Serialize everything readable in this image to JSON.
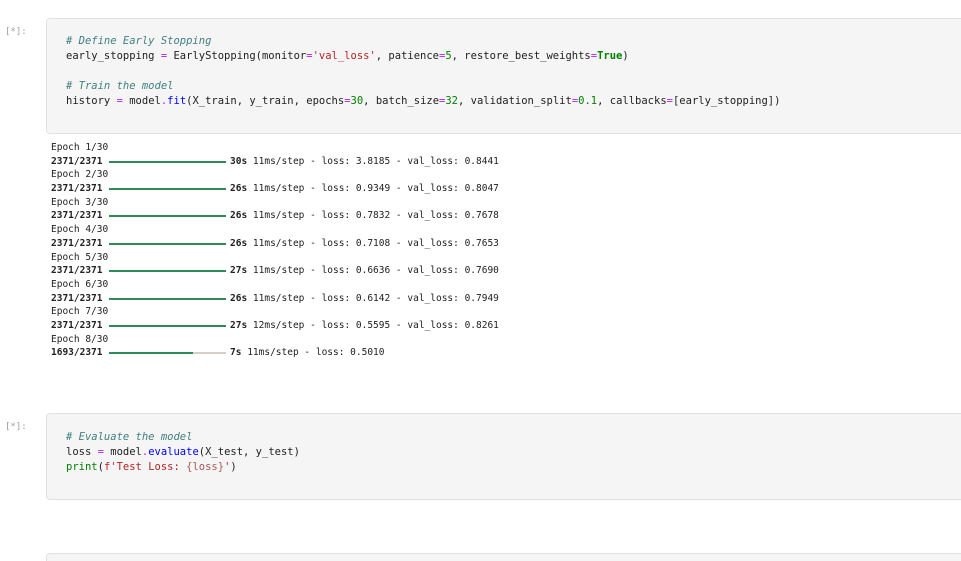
{
  "cells": [
    {
      "prompt": "[*]:",
      "lines": [
        [
          {
            "t": "# Define Early Stopping",
            "c": "cm"
          }
        ],
        [
          {
            "t": "early_stopping ",
            "c": ""
          },
          {
            "t": "=",
            "c": "op"
          },
          {
            "t": " EarlyStopping(monitor",
            "c": ""
          },
          {
            "t": "=",
            "c": "op"
          },
          {
            "t": "'val_loss'",
            "c": "str"
          },
          {
            "t": ", patience",
            "c": ""
          },
          {
            "t": "=",
            "c": "op"
          },
          {
            "t": "5",
            "c": "num"
          },
          {
            "t": ", restore_best_weights",
            "c": ""
          },
          {
            "t": "=",
            "c": "op"
          },
          {
            "t": "True",
            "c": "kw"
          },
          {
            "t": ")",
            "c": ""
          }
        ],
        [],
        [
          {
            "t": "# Train the model",
            "c": "cm"
          }
        ],
        [
          {
            "t": "history ",
            "c": ""
          },
          {
            "t": "=",
            "c": "op"
          },
          {
            "t": " model",
            "c": ""
          },
          {
            "t": ".",
            "c": "op"
          },
          {
            "t": "fit",
            "c": "fn"
          },
          {
            "t": "(X_train, y_train, epochs",
            "c": ""
          },
          {
            "t": "=",
            "c": "op"
          },
          {
            "t": "30",
            "c": "num"
          },
          {
            "t": ", batch_size",
            "c": ""
          },
          {
            "t": "=",
            "c": "op"
          },
          {
            "t": "32",
            "c": "num"
          },
          {
            "t": ", validation_split",
            "c": ""
          },
          {
            "t": "=",
            "c": "op"
          },
          {
            "t": "0.1",
            "c": "num"
          },
          {
            "t": ", callbacks",
            "c": ""
          },
          {
            "t": "=",
            "c": "op"
          },
          {
            "t": "[early_stopping])",
            "c": ""
          }
        ]
      ]
    },
    {
      "prompt": "[*]:",
      "lines": [
        [
          {
            "t": "# Evaluate the model",
            "c": "cm"
          }
        ],
        [
          {
            "t": "loss ",
            "c": ""
          },
          {
            "t": "=",
            "c": "op"
          },
          {
            "t": " model",
            "c": ""
          },
          {
            "t": ".",
            "c": "op"
          },
          {
            "t": "evaluate",
            "c": "fn"
          },
          {
            "t": "(X_test, y_test)",
            "c": ""
          }
        ],
        [
          {
            "t": "print",
            "c": "bi"
          },
          {
            "t": "(",
            "c": ""
          },
          {
            "t": "f'Test Loss: ",
            "c": "str"
          },
          {
            "t": "{loss}",
            "c": "interp"
          },
          {
            "t": "'",
            "c": "str"
          },
          {
            "t": ")",
            "c": ""
          }
        ]
      ]
    }
  ],
  "training_output": [
    {
      "epoch": "Epoch 1/30",
      "steps": "2371/2371",
      "progress": 1.0,
      "time": "30s",
      "per_step": "11ms/step",
      "loss": "loss: 3.8185",
      "val_loss": "val_loss: 0.8441"
    },
    {
      "epoch": "Epoch 2/30",
      "steps": "2371/2371",
      "progress": 1.0,
      "time": "26s",
      "per_step": "11ms/step",
      "loss": "loss: 0.9349",
      "val_loss": "val_loss: 0.8047"
    },
    {
      "epoch": "Epoch 3/30",
      "steps": "2371/2371",
      "progress": 1.0,
      "time": "26s",
      "per_step": "11ms/step",
      "loss": "loss: 0.7832",
      "val_loss": "val_loss: 0.7678"
    },
    {
      "epoch": "Epoch 4/30",
      "steps": "2371/2371",
      "progress": 1.0,
      "time": "26s",
      "per_step": "11ms/step",
      "loss": "loss: 0.7108",
      "val_loss": "val_loss: 0.7653"
    },
    {
      "epoch": "Epoch 5/30",
      "steps": "2371/2371",
      "progress": 1.0,
      "time": "27s",
      "per_step": "11ms/step",
      "loss": "loss: 0.6636",
      "val_loss": "val_loss: 0.7690"
    },
    {
      "epoch": "Epoch 6/30",
      "steps": "2371/2371",
      "progress": 1.0,
      "time": "26s",
      "per_step": "11ms/step",
      "loss": "loss: 0.6142",
      "val_loss": "val_loss: 0.7949"
    },
    {
      "epoch": "Epoch 7/30",
      "steps": "2371/2371",
      "progress": 1.0,
      "time": "27s",
      "per_step": "12ms/step",
      "loss": "loss: 0.5595",
      "val_loss": "val_loss: 0.8261"
    },
    {
      "epoch": "Epoch 8/30",
      "steps": "1693/2371",
      "progress": 0.714,
      "time": "7s",
      "per_step": "11ms/step",
      "loss": "loss: 0.5010",
      "val_loss": ""
    }
  ],
  "colors": {
    "progress_fill": "#2e8b57",
    "progress_track": "#d5d0c8",
    "cell_background": "#f5f5f5"
  }
}
